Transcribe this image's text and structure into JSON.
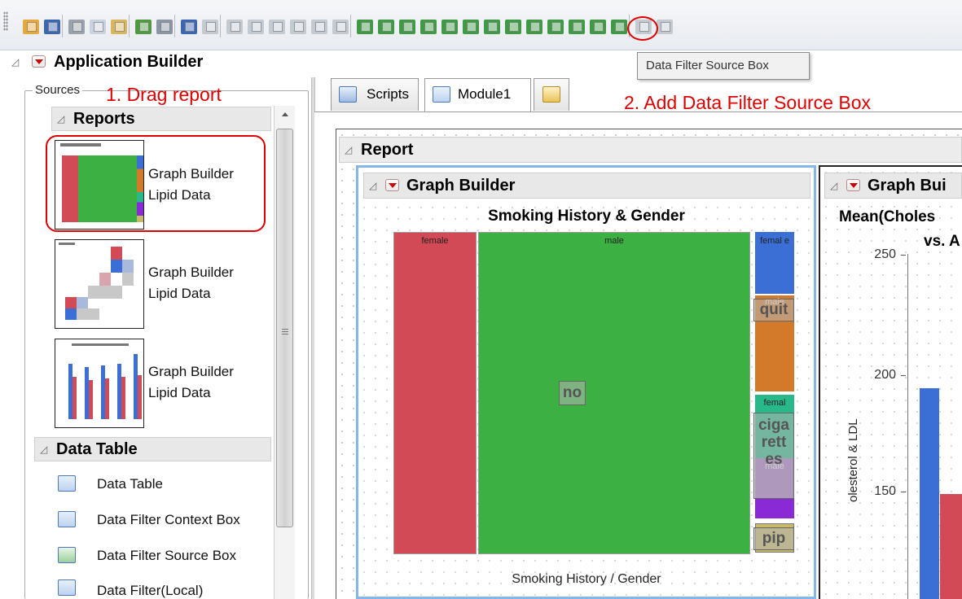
{
  "toolbar": {
    "icons": [
      {
        "name": "open-folder-icon",
        "color": "#e6a93b"
      },
      {
        "name": "save-icon",
        "color": "#3d66b0"
      },
      {
        "name": "cut-icon",
        "color": "#9aa3ad"
      },
      {
        "name": "copy-icon",
        "color": "#c9d3df"
      },
      {
        "name": "paste-icon",
        "color": "#d9b560"
      },
      {
        "name": "run-script-icon",
        "color": "#4f9a3e"
      },
      {
        "name": "debug-icon",
        "color": "#8b95a3"
      },
      {
        "name": "edit-module-icon",
        "color": "#3d66b0"
      },
      {
        "name": "disabled-module-icon",
        "color": "#c4cad2"
      },
      {
        "name": "align-left-icon",
        "color": "#c4cad2"
      },
      {
        "name": "align-center-icon",
        "color": "#c4cad2"
      },
      {
        "name": "align-right-icon",
        "color": "#c4cad2"
      },
      {
        "name": "align-top-icon",
        "color": "#c4cad2"
      },
      {
        "name": "align-middle-icon",
        "color": "#c4cad2"
      },
      {
        "name": "align-bottom-icon",
        "color": "#c4cad2"
      },
      {
        "name": "add-outline-box-icon",
        "color": "#3f9a45"
      },
      {
        "name": "add-tab-box-icon",
        "color": "#3f9a45"
      },
      {
        "name": "add-splitter-box-icon",
        "color": "#3f9a45"
      },
      {
        "name": "add-data-filter-context-icon",
        "color": "#3f9a45"
      },
      {
        "name": "add-data-filter-source-icon",
        "color": "#3f9a45"
      },
      {
        "name": "add-h-list-icon",
        "color": "#3f9a45"
      },
      {
        "name": "add-v-list-icon",
        "color": "#3f9a45"
      },
      {
        "name": "add-h-splitter-icon",
        "color": "#3f9a45"
      },
      {
        "name": "add-v-splitter-icon",
        "color": "#3f9a45"
      },
      {
        "name": "add-border-box-icon",
        "color": "#3f9a45"
      },
      {
        "name": "add-spacer-icon",
        "color": "#3f9a45"
      },
      {
        "name": "add-panel-box-icon",
        "color": "#3f9a45"
      },
      {
        "name": "add-page-box-icon",
        "color": "#3f9a45"
      },
      {
        "name": "disabled-upload-icon",
        "color": "#c4cad2"
      },
      {
        "name": "disabled-extra-icon",
        "color": "#c4cad2"
      }
    ],
    "tooltip": "Data Filter Source Box"
  },
  "app": {
    "title": "Application Builder"
  },
  "annotations": {
    "step1": "1. Drag report",
    "step2": "2. Add Data Filter Source Box"
  },
  "sources": {
    "legend": "Sources",
    "reports_heading": "Reports",
    "reports": [
      {
        "label_line1": "Graph Builder",
        "label_line2": "Lipid Data"
      },
      {
        "label_line1": "Graph Builder",
        "label_line2": "Lipid Data"
      },
      {
        "label_line1": "Graph Builder",
        "label_line2": "Lipid Data"
      }
    ],
    "data_table_heading": "Data Table",
    "data_table_items": [
      {
        "label": "Data Table",
        "icon": "data-table-icon"
      },
      {
        "label": "Data Filter Context Box",
        "icon": "data-filter-context-icon"
      },
      {
        "label": "Data Filter Source Box",
        "icon": "data-filter-source-icon"
      },
      {
        "label": "Data Filter(Local)",
        "icon": "data-filter-local-icon"
      }
    ]
  },
  "tabs": [
    {
      "label": "Scripts",
      "icon": "scripts-icon"
    },
    {
      "label": "Module1",
      "icon": "module-icon"
    },
    {
      "label": "",
      "icon": "new-module-icon"
    }
  ],
  "report": {
    "heading": "Report",
    "graph1": {
      "heading": "Graph Builder",
      "title": "Smoking History & Gender",
      "x_label": "Smoking History / Gender",
      "mosaic": {
        "colors": {
          "female_no": "#d24a55",
          "male_no": "#3cb043",
          "female_quit": "#3b6fd6",
          "male_quit": "#d27a2a",
          "female_cig": "#29b88a",
          "male_cig": "#a678c8",
          "male_cig2": "#8a2ad6",
          "male_pipe": "#c7b96a"
        },
        "labels": {
          "female": "female",
          "male": "male",
          "female_wrap": "femal e",
          "female_short": "femal",
          "male_small": "male"
        },
        "big_labels": {
          "no": "no",
          "quit": "quit",
          "cigarettes": "ciga rett es",
          "pipe": "pip"
        }
      }
    },
    "graph2": {
      "heading": "Graph Bui",
      "title_line1": "Mean(Choles",
      "title_line2": "vs. A",
      "y_label": "olesterol & LDL",
      "y_ticks": [
        "250",
        "200",
        "150"
      ],
      "colors": {
        "blue": "#3b6fd6",
        "red": "#d24a55"
      }
    }
  }
}
